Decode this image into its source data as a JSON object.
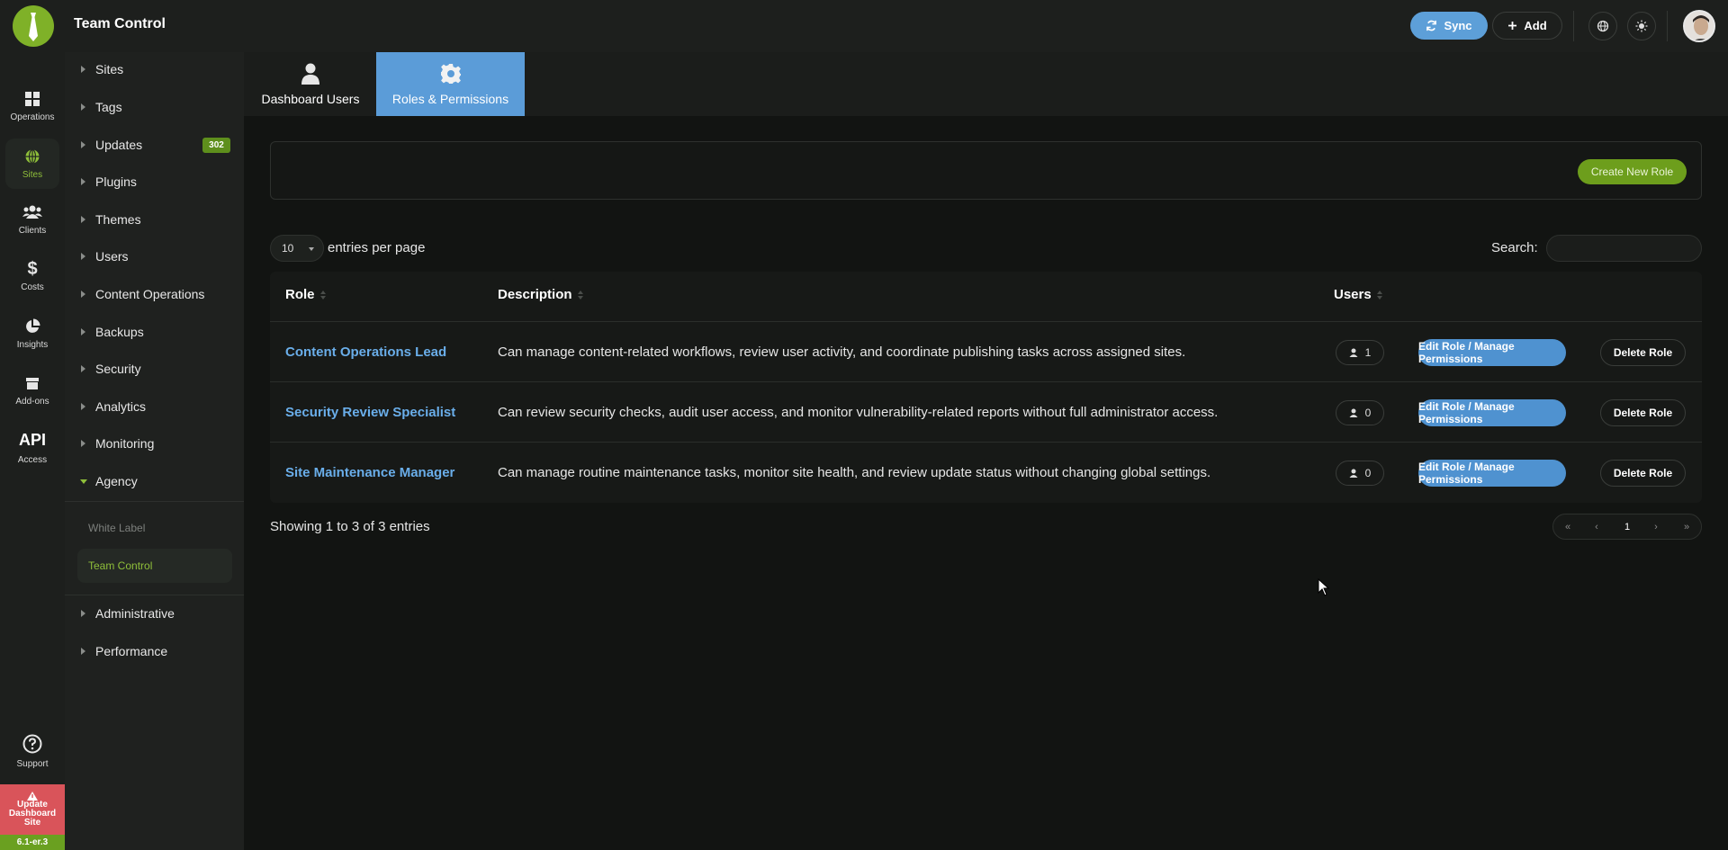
{
  "header": {
    "title": "Team Control",
    "sync_label": "Sync",
    "add_label": "Add"
  },
  "rail": {
    "items": [
      {
        "label": "Operations",
        "icon": "grid-icon"
      },
      {
        "label": "Sites",
        "icon": "globe-icon"
      },
      {
        "label": "Clients",
        "icon": "users-icon"
      },
      {
        "label": "Costs",
        "icon": "dollar-icon"
      },
      {
        "label": "Insights",
        "icon": "pie-chart-icon"
      },
      {
        "label": "Add-ons",
        "icon": "box-icon"
      },
      {
        "label": "Access",
        "icon": "api-icon",
        "glyph": "API"
      }
    ],
    "support_label": "Support",
    "update_lines": [
      "Update",
      "Dashboard",
      "Site"
    ],
    "version": "6.1-er.3"
  },
  "nav": {
    "items": [
      {
        "label": "Sites"
      },
      {
        "label": "Tags"
      },
      {
        "label": "Updates",
        "badge": "302"
      },
      {
        "label": "Plugins"
      },
      {
        "label": "Themes"
      },
      {
        "label": "Users"
      },
      {
        "label": "Content Operations"
      },
      {
        "label": "Backups"
      },
      {
        "label": "Security"
      },
      {
        "label": "Analytics"
      },
      {
        "label": "Monitoring"
      },
      {
        "label": "Agency"
      },
      {
        "label": "Administrative"
      },
      {
        "label": "Performance"
      }
    ],
    "agency_sub": [
      {
        "label": "White Label"
      },
      {
        "label": "Team Control"
      }
    ]
  },
  "tabs": [
    {
      "label": "Dashboard Users",
      "icon": "user-icon"
    },
    {
      "label": "Roles & Permissions",
      "icon": "gear-icon"
    }
  ],
  "toolbar": {
    "create_label": "Create New Role",
    "length_value": "10",
    "length_label": "entries per page",
    "search_label": "Search:",
    "search_value": ""
  },
  "table": {
    "columns": [
      "Role",
      "Description",
      "Users"
    ],
    "rows": [
      {
        "role": "Content Operations Lead",
        "description": "Can manage content-related workflows, review user activity, and coordinate publishing tasks across assigned sites.",
        "users": "1"
      },
      {
        "role": "Security Review Specialist",
        "description": "Can review security checks, audit user access, and monitor vulnerability-related reports without full administrator access.",
        "users": "0"
      },
      {
        "role": "Site Maintenance Manager",
        "description": "Can manage routine maintenance tasks, monitor site health, and review update status without changing global settings.",
        "users": "0"
      }
    ],
    "edit_label": "Edit Role / Manage Permissions",
    "delete_label": "Delete Role"
  },
  "footer": {
    "info": "Showing 1 to 3 of 3 entries",
    "pager": [
      "«",
      "‹",
      "1",
      "›",
      "»"
    ]
  },
  "colors": {
    "accent_green": "#6d9e1c",
    "accent_blue": "#5b9cd8",
    "link_blue": "#6aaeea",
    "warning_red": "#d9545a"
  }
}
